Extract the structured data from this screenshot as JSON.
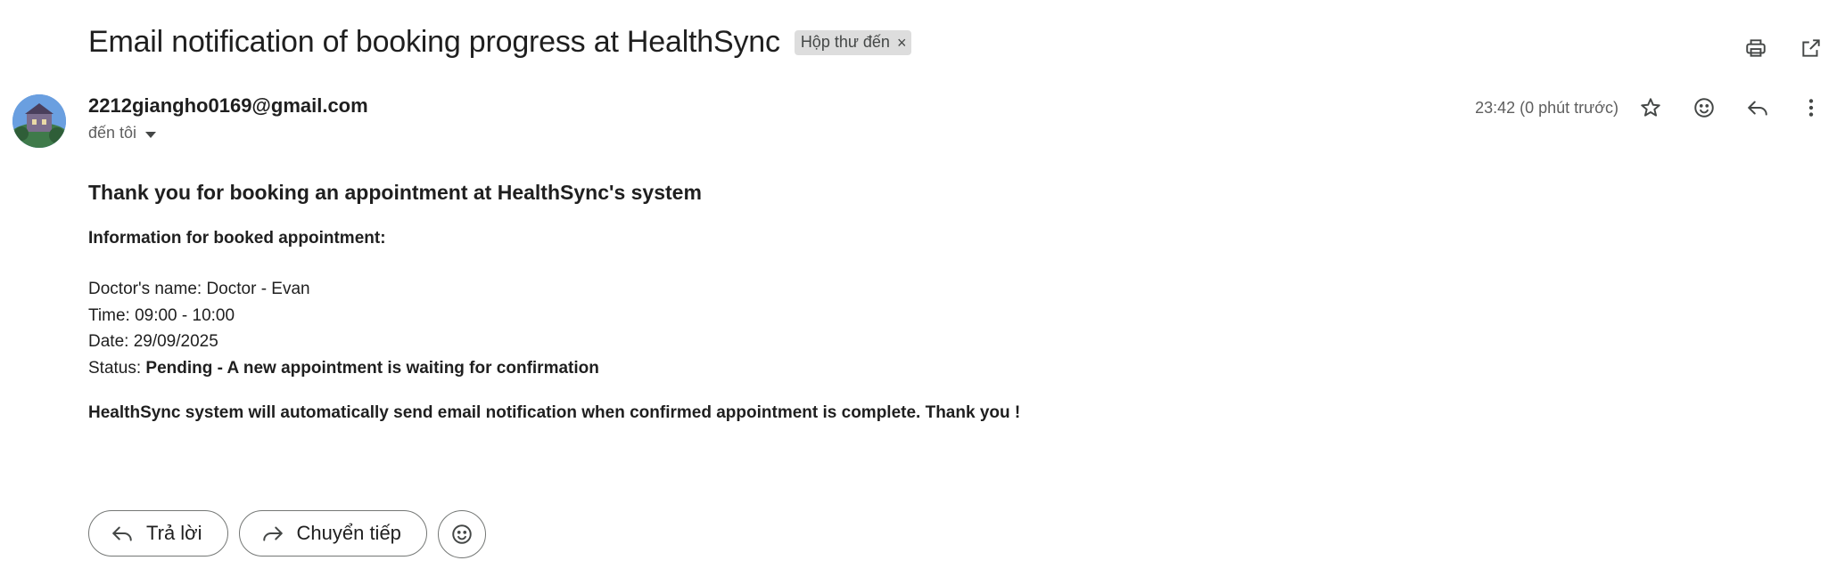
{
  "email": {
    "subject": "Email notification of booking progress at HealthSync",
    "label": "Hộp thư đến",
    "label_close": "×",
    "sender": "2212giangho0169@gmail.com",
    "recipient": "đến tôi",
    "timestamp": "23:42 (0 phút trước)"
  },
  "icons": {
    "top": [
      "print-icon",
      "open-in-new-window-icon"
    ],
    "message": [
      "star-icon",
      "emoji-react-icon",
      "reply-icon",
      "more-vert-icon"
    ]
  },
  "content": {
    "heading": "Thank you for booking an appointment at HealthSync's system",
    "info_title": "Information for booked appointment:",
    "doctor": "Doctor's name: Doctor - Evan",
    "time": "Time: 09:00 - 10:00",
    "date": "Date: 29/09/2025",
    "status_label": "Status: ",
    "status_value": "Pending - A new appointment is waiting for confirmation",
    "closing": "HealthSync system will automatically send email notification when confirmed appointment is complete. Thank you !"
  },
  "actions": {
    "reply": "Trả lời",
    "forward": "Chuyển tiếp"
  }
}
